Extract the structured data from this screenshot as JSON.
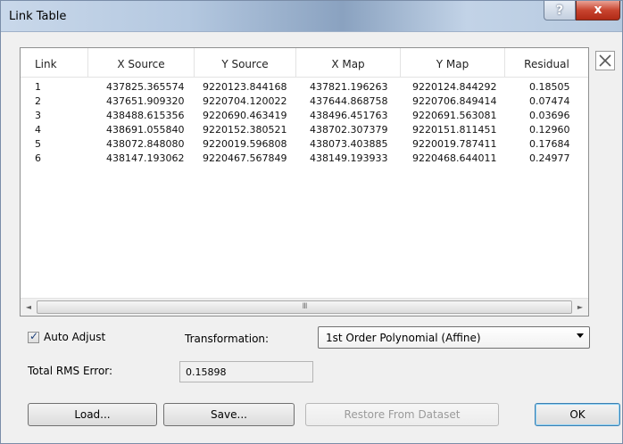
{
  "window": {
    "title": "Link Table"
  },
  "titlebar": {
    "help_glyph": "?",
    "close_glyph": "x"
  },
  "table": {
    "columns": [
      "Link",
      "X Source",
      "Y Source",
      "X Map",
      "Y Map",
      "Residual"
    ],
    "rows": [
      [
        "1",
        "437825.365574",
        "9220123.844168",
        "437821.196263",
        "9220124.844292",
        "0.18505"
      ],
      [
        "2",
        "437651.909320",
        "9220704.120022",
        "437644.868758",
        "9220706.849414",
        "0.07474"
      ],
      [
        "3",
        "438488.615356",
        "9220690.463419",
        "438496.451763",
        "9220691.563081",
        "0.03696"
      ],
      [
        "4",
        "438691.055840",
        "9220152.380521",
        "438702.307379",
        "9220151.811451",
        "0.12960"
      ],
      [
        "5",
        "438072.848080",
        "9220019.596808",
        "438073.403885",
        "9220019.787411",
        "0.17684"
      ],
      [
        "6",
        "438147.193062",
        "9220467.567849",
        "438149.193933",
        "9220468.644011",
        "0.24977"
      ]
    ],
    "scroll_left": "◄",
    "scroll_right": "►",
    "scroll_grip": "III"
  },
  "auto_adjust": {
    "label": "Auto Adjust",
    "checked": true,
    "check_glyph": "✓"
  },
  "transformation": {
    "label": "Transformation:",
    "value": "1st Order Polynomial (Affine)"
  },
  "rms": {
    "label": "Total RMS Error:",
    "value": "0.15898"
  },
  "buttons": {
    "load": "Load...",
    "save": "Save...",
    "restore": "Restore From Dataset",
    "ok": "OK"
  }
}
